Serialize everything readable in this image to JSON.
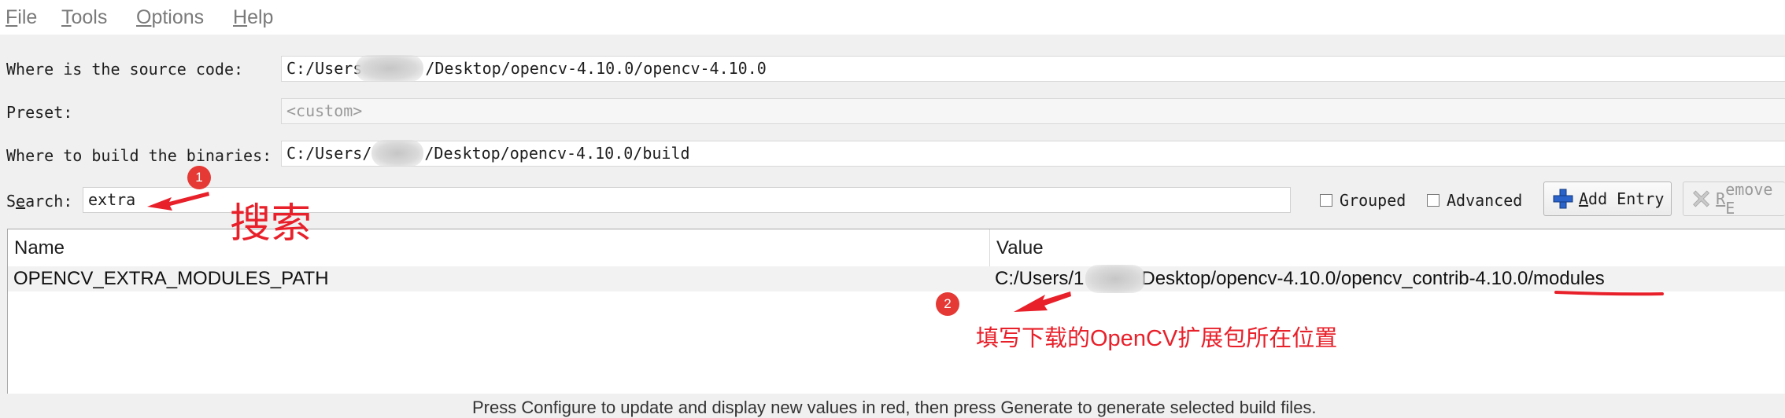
{
  "menu": {
    "file": {
      "accel": "F",
      "rest": "ile"
    },
    "tools": {
      "accel": "T",
      "rest": "ools"
    },
    "options": {
      "accel": "O",
      "rest": "ptions"
    },
    "help": {
      "accel": "H",
      "rest": "elp"
    }
  },
  "form": {
    "source_label": "Where is the source code:",
    "source_value_prefix": "C:/Users",
    "source_value_suffix": "/Desktop/opencv-4.10.0/opencv-4.10.0",
    "preset_label": "Preset:",
    "preset_value": "<custom>",
    "build_label": "Where to build the binaries:",
    "build_value_prefix": "C:/Users/",
    "build_value_suffix": "/Desktop/opencv-4.10.0/build"
  },
  "search": {
    "label_pre": "S",
    "label_accel": "e",
    "label_post": "arch:",
    "value": "extra",
    "grouped_label": "Grouped",
    "advanced_label": "Advanced",
    "add_entry_accel": "A",
    "add_entry_rest": "dd Entry",
    "remove_accel": "R",
    "remove_rest": "emove E"
  },
  "table": {
    "columns": [
      "Name",
      "Value"
    ],
    "rows": [
      {
        "name": "OPENCV_EXTRA_MODULES_PATH",
        "value_prefix": "C:/Users/1",
        "value_suffix": "Desktop/opencv-4.10.0/opencv_contrib-4.10.0/modules"
      }
    ]
  },
  "annotations": {
    "badge1": "1",
    "search_note": "搜索",
    "badge2": "2",
    "path_note": "填写下载的OpenCV扩展包所在位置",
    "color": "#e8202a"
  },
  "bottom_partial_text": "Press Configure to update and display new values in red, then press Generate to generate selected build files."
}
